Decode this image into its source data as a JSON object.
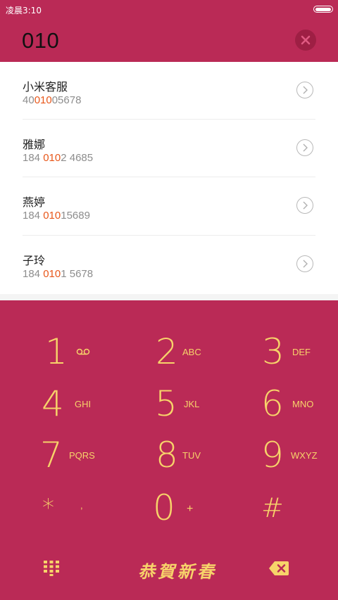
{
  "status_bar": {
    "time": "凌晨3:10"
  },
  "dial": {
    "number": "010"
  },
  "contacts": [
    {
      "name": "小米客服",
      "phone_pre": "40",
      "phone_match": "010",
      "phone_post": "05678"
    },
    {
      "name": "雅娜",
      "phone_pre": "184 ",
      "phone_match": "010",
      "phone_post": "2 4685"
    },
    {
      "name": "燕婷",
      "phone_pre": "184 ",
      "phone_match": "010",
      "phone_post": "15689"
    },
    {
      "name": "子玲",
      "phone_pre": "184 ",
      "phone_match": "010",
      "phone_post": "1 5678"
    }
  ],
  "keypad": {
    "keys": [
      {
        "digit": "1",
        "letters": ""
      },
      {
        "digit": "2",
        "letters": "ABC"
      },
      {
        "digit": "3",
        "letters": "DEF"
      },
      {
        "digit": "4",
        "letters": "GHI"
      },
      {
        "digit": "5",
        "letters": "JKL"
      },
      {
        "digit": "6",
        "letters": "MNO"
      },
      {
        "digit": "7",
        "letters": "PQRS"
      },
      {
        "digit": "8",
        "letters": "TUV"
      },
      {
        "digit": "9",
        "letters": "WXYZ"
      },
      {
        "digit": "*",
        "letters": ","
      },
      {
        "digit": "0",
        "letters": "+"
      },
      {
        "digit": "#",
        "letters": ""
      }
    ],
    "greeting": "恭賀新春"
  },
  "colors": {
    "accent": "#ba2a56",
    "keypad_text": "#f7d36a",
    "highlight": "#e8571a"
  }
}
